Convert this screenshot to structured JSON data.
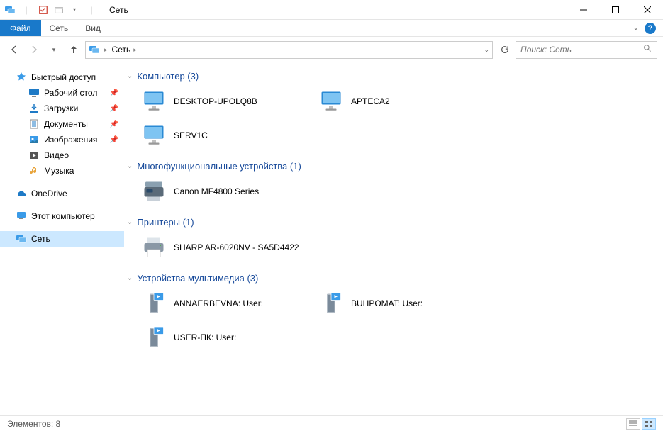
{
  "title": "Сеть",
  "ribbon": {
    "file": "Файл",
    "tabs": [
      "Сеть",
      "Вид"
    ]
  },
  "breadcrumb": [
    "Сеть"
  ],
  "search_placeholder": "Поиск: Сеть",
  "sidebar": {
    "quick_access": "Быстрый доступ",
    "desktop": "Рабочий стол",
    "downloads": "Загрузки",
    "documents": "Документы",
    "pictures": "Изображения",
    "videos": "Видео",
    "music": "Музыка",
    "onedrive": "OneDrive",
    "this_pc": "Этот компьютер",
    "network": "Сеть"
  },
  "groups": [
    {
      "title": "Компьютер (3)",
      "type": "computer",
      "items": [
        "DESKTOP-UPOLQ8B",
        "APTECA2",
        "SERV1C"
      ]
    },
    {
      "title": "Многофункциональные устройства (1)",
      "type": "mfp",
      "items": [
        "Canon MF4800 Series"
      ]
    },
    {
      "title": "Принтеры (1)",
      "type": "printer",
      "items": [
        "SHARP AR-6020NV - SA5D4422"
      ]
    },
    {
      "title": "Устройства мультимедиа (3)",
      "type": "media",
      "items": [
        "ANNAERBEVNA: User:",
        "BUHPOMAT: User:",
        "USER-ПК: User:"
      ]
    }
  ],
  "status": "Элементов: 8"
}
